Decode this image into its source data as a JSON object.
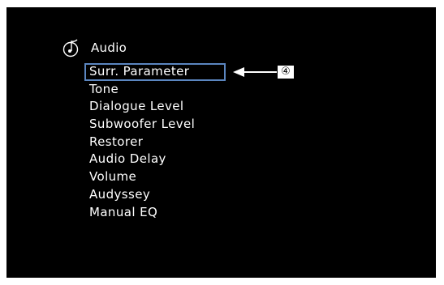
{
  "menu": {
    "title": "Audio",
    "icon": "audio-note-icon",
    "items": [
      {
        "label": "Surr. Parameter",
        "selected": true
      },
      {
        "label": "Tone"
      },
      {
        "label": "Dialogue Level"
      },
      {
        "label": "Subwoofer Level"
      },
      {
        "label": "Restorer"
      },
      {
        "label": "Audio Delay"
      },
      {
        "label": "Volume"
      },
      {
        "label": "Audyssey"
      },
      {
        "label": "Manual EQ"
      }
    ]
  },
  "callout": {
    "number": "④",
    "icon": "arrow-left-icon"
  },
  "colors": {
    "screen_background": "#000000",
    "text": "#ffffff",
    "selection_border": "#5b86c0"
  }
}
